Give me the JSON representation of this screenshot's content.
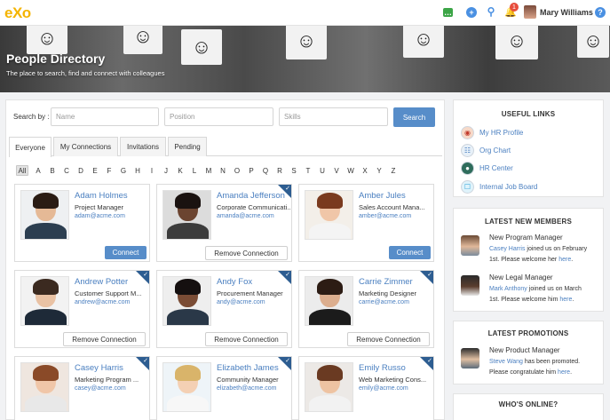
{
  "app": {
    "logo": "eXo",
    "notification_count": "1",
    "user_name": "Mary Williams"
  },
  "banner": {
    "title": "People Directory",
    "subtitle": "The place to search, find and connect with colleagues"
  },
  "search": {
    "label": "Search by :",
    "name_placeholder": "Name",
    "position_placeholder": "Position",
    "skills_placeholder": "Skills",
    "button": "Search"
  },
  "tabs": [
    {
      "label": "Everyone",
      "active": true
    },
    {
      "label": "My Connections",
      "active": false
    },
    {
      "label": "Invitations",
      "active": false
    },
    {
      "label": "Pending",
      "active": false
    }
  ],
  "alphabet": [
    "All",
    "A",
    "B",
    "C",
    "D",
    "E",
    "F",
    "G",
    "H",
    "I",
    "J",
    "K",
    "L",
    "M",
    "N",
    "O",
    "P",
    "Q",
    "R",
    "S",
    "T",
    "U",
    "V",
    "W",
    "X",
    "Y",
    "Z"
  ],
  "people": [
    {
      "name": "Adam Holmes",
      "role": "Project Manager",
      "email": "adam@acme.com",
      "action": "Connect",
      "connected": false
    },
    {
      "name": "Amanda Jefferson",
      "role": "Corporate Communicati...",
      "email": "amanda@acme.com",
      "action": "Remove Connection",
      "connected": true
    },
    {
      "name": "Amber Jules",
      "role": "Sales Account Mana...",
      "email": "amber@acme.com",
      "action": "Connect",
      "connected": false
    },
    {
      "name": "Andrew Potter",
      "role": "Customer Support M...",
      "email": "andrew@acme.com",
      "action": "Remove Connection",
      "connected": true
    },
    {
      "name": "Andy Fox",
      "role": "Procurement Manager",
      "email": "andy@acme.com",
      "action": "Remove Connection",
      "connected": true
    },
    {
      "name": "Carrie Zimmer",
      "role": "Marketing Designer",
      "email": "carrie@acme.com",
      "action": "Remove Connection",
      "connected": true
    },
    {
      "name": "Casey Harris",
      "role": "Marketing Program ...",
      "email": "casey@acme.com",
      "action": "",
      "connected": true
    },
    {
      "name": "Elizabeth James",
      "role": "Community Manager",
      "email": "elizabeth@acme.com",
      "action": "",
      "connected": true
    },
    {
      "name": "Emily Russo",
      "role": "Web Marketing Cons...",
      "email": "emily@acme.com",
      "action": "",
      "connected": true
    }
  ],
  "useful_links": {
    "title": "USEFUL LINKS",
    "items": [
      "My HR Profile",
      "Org Chart",
      "HR Center",
      "Internal Job Board"
    ]
  },
  "latest_members": {
    "title": "LATEST NEW MEMBERS",
    "items": [
      {
        "title": "New Program Manager",
        "person": "Casey Harris",
        "text1": " joined us on February",
        "text2": "1st. Please welcome her ",
        "link": "here",
        "end": "."
      },
      {
        "title": "New Legal Manager",
        "person": "Mark Anthony",
        "text1": " joined us on March",
        "text2": "1st. Please welcome him ",
        "link": "here",
        "end": "."
      }
    ]
  },
  "latest_promotions": {
    "title": "LATEST PROMOTIONS",
    "items": [
      {
        "title": "New Product Manager",
        "person": "Steve Wang",
        "text1": " has been promoted.",
        "text2": "Please congratulate him ",
        "link": "here",
        "end": "."
      }
    ]
  },
  "whos_online": {
    "title": "WHO'S ONLINE?"
  }
}
